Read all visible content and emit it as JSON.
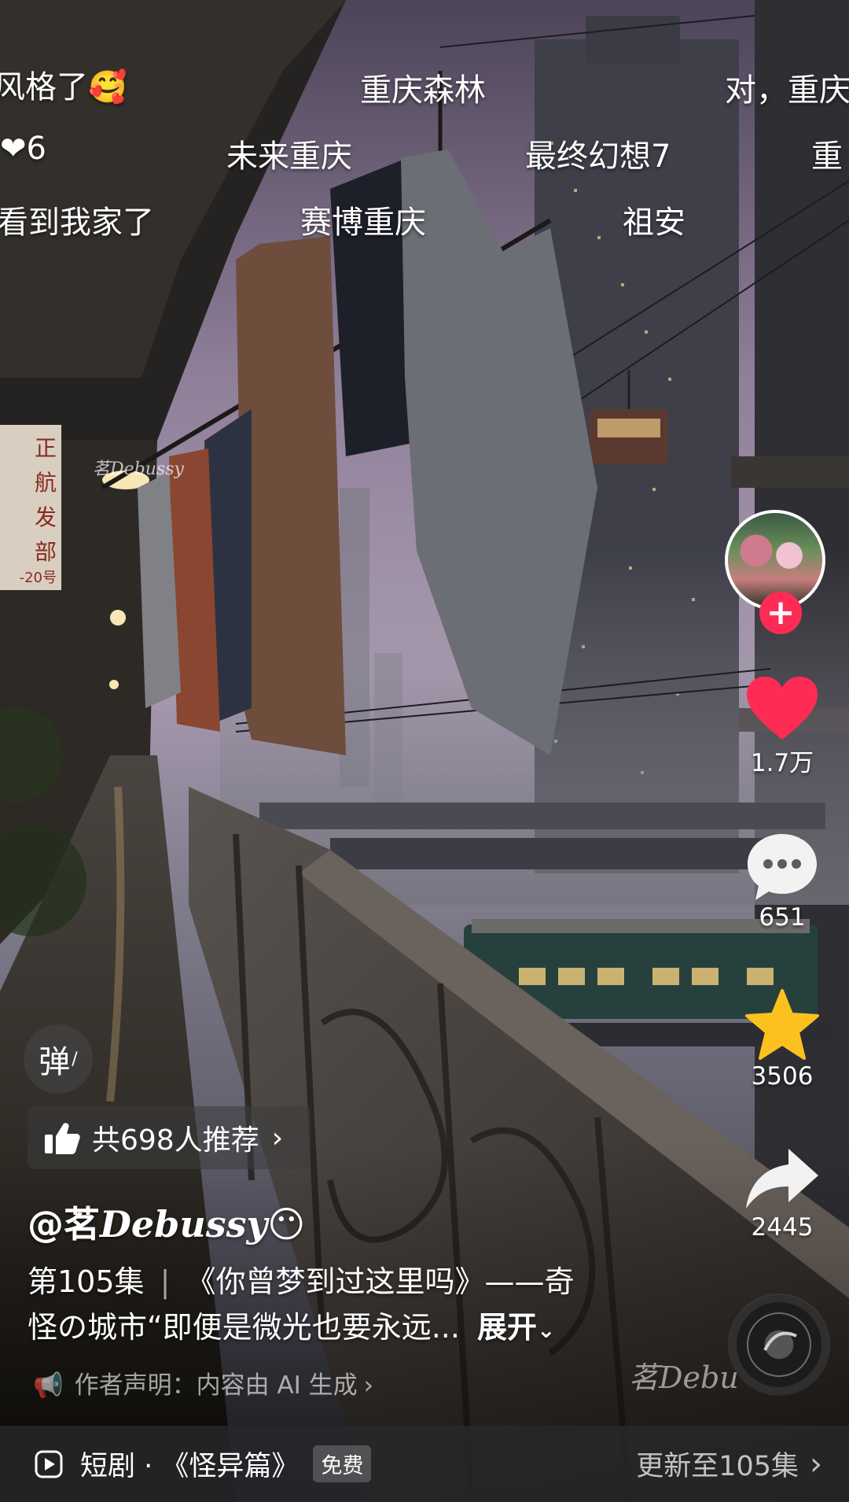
{
  "danmaku": {
    "row1": [
      "风格了🥰",
      "重庆森林",
      "对，重庆"
    ],
    "row2": [
      "6",
      "未来重庆",
      "最终幻想7",
      "重"
    ],
    "row3": [
      "看到我家了",
      "赛博重庆",
      "祖安"
    ]
  },
  "sign_board": {
    "lines": [
      "正",
      "航",
      "发",
      "部"
    ],
    "number": "-20号"
  },
  "actions": {
    "like_count": "1.7万",
    "comment_count": "651",
    "favorite_count": "3506",
    "share_count": "2445"
  },
  "danmu_toggle_label": "弹",
  "recommend": {
    "label": "共698人推荐"
  },
  "author": {
    "name": "@茗",
    "signature": "Debussy",
    "emoji": "😶"
  },
  "description": {
    "episode": "第105集",
    "text_line1": "《你曾梦到过这里吗》——奇",
    "text_line2": "怪の城市“即便是微光也要永远...",
    "expand_label": "展开"
  },
  "ai_note": "作者声明：内容由 AI 生成",
  "watermark": {
    "prefix": "茗",
    "signature": "Debu"
  },
  "sign_watermark": "茗Debussy",
  "series_bar": {
    "label": "短剧 · 《怪异篇》",
    "badge": "免费",
    "update": "更新至105集"
  },
  "colors": {
    "accent": "#fe2c55",
    "favorite": "#fcc11f"
  }
}
